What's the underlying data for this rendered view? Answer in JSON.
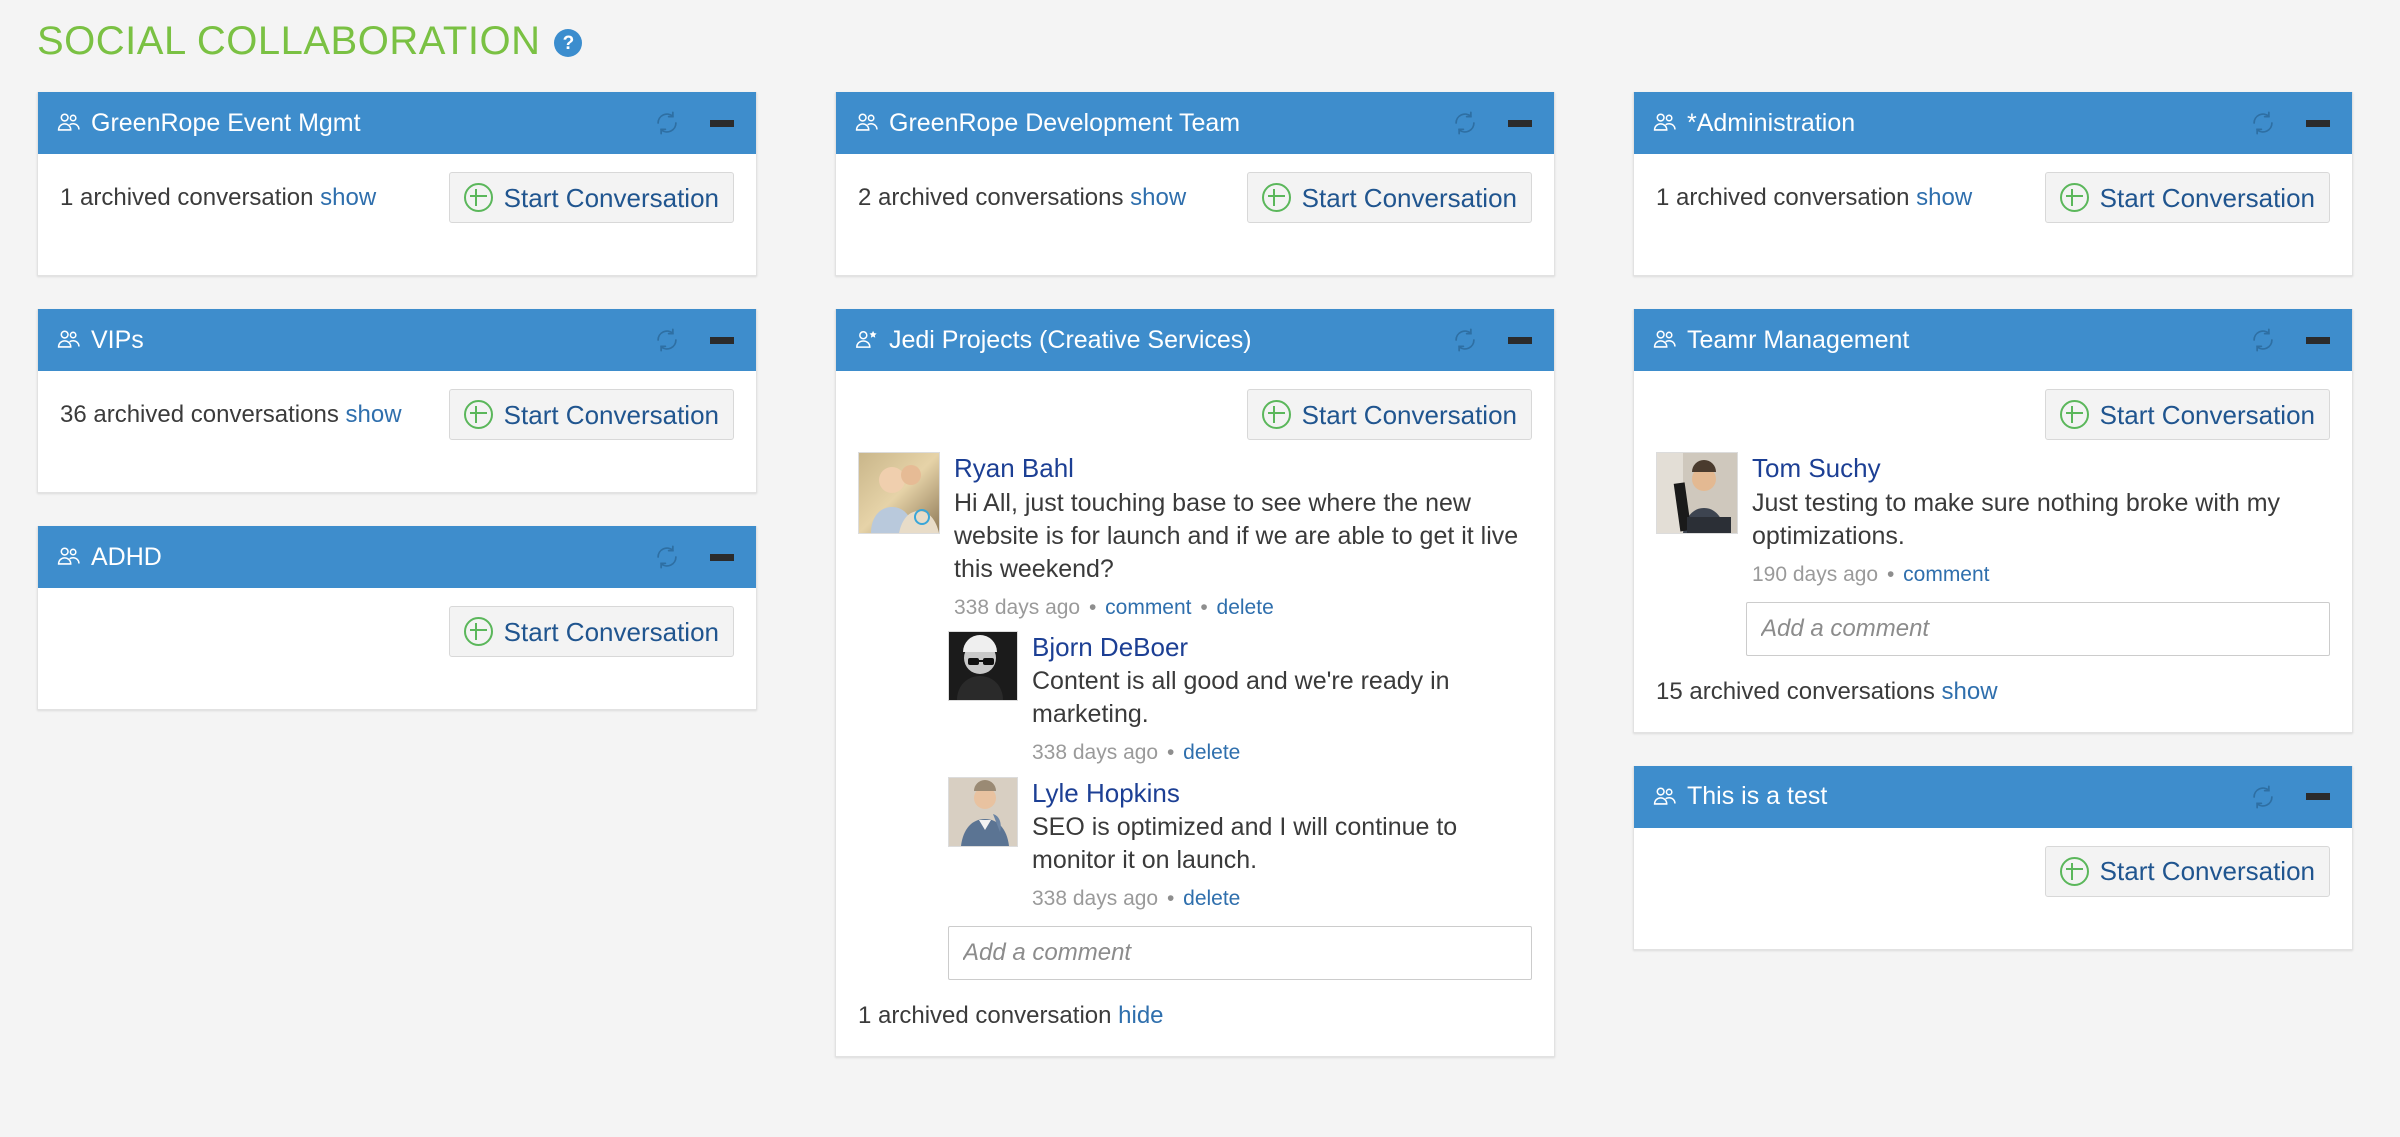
{
  "header": {
    "title": "SOCIAL COLLABORATION",
    "help_icon": "question-mark-icon",
    "help_label": "?",
    "title_color": "#7ac143",
    "help_bg_color": "#3b8dce"
  },
  "theme": {
    "card_header_bg": "#3e8dcc",
    "page_bg": "#f4f4f4",
    "link_color": "#2f6fad",
    "author_color": "#1c3f94",
    "plus_icon_color": "#5bb75b",
    "button_text_color": "#20558f"
  },
  "common": {
    "start_conversation_label": "Start Conversation",
    "comment_placeholder": "Add a comment",
    "refresh_icon": "refresh-icon",
    "minimize_icon": "minimize-icon",
    "group_icon": "group-users-icon",
    "user_star_icon": "user-star-icon",
    "plus_icon": "circle-plus-icon",
    "show_label": "show",
    "hide_label": "hide",
    "comment_label": "comment",
    "delete_label": "delete",
    "separator": "•"
  },
  "columns": [
    {
      "id": "column-1",
      "cards": [
        {
          "id": "greenrope-event-mgmt",
          "title": "GreenRope Event Mgmt",
          "icon": "group-users-icon",
          "archived_text": "1 archived conversation",
          "archived_action": "show",
          "archived_position": "top",
          "posts": []
        },
        {
          "id": "vips",
          "title": "VIPs",
          "icon": "group-users-icon",
          "archived_text": "36 archived conversations",
          "archived_action": "show",
          "archived_position": "top",
          "posts": []
        },
        {
          "id": "adhd",
          "title": "ADHD",
          "icon": "group-users-icon",
          "archived_text": "",
          "archived_action": "",
          "archived_position": "none",
          "posts": []
        }
      ]
    },
    {
      "id": "column-2",
      "cards": [
        {
          "id": "greenrope-development-team",
          "title": "GreenRope Development Team",
          "icon": "group-users-icon",
          "archived_text": "2 archived conversations",
          "archived_action": "show",
          "archived_position": "top",
          "posts": []
        },
        {
          "id": "jedi-projects-creative-services",
          "title": "Jedi Projects (Creative Services)",
          "icon": "user-star-icon",
          "archived_text": "1 archived conversation",
          "archived_action": "hide",
          "archived_position": "bottom",
          "posts": [
            {
              "author": "Ryan Bahl",
              "avatar": "photo-couple-outdoors",
              "text": "Hi All, just touching base to see where the new website is for launch and if we are able to get it live this weekend?",
              "time": "338 days ago",
              "actions": [
                "comment",
                "delete"
              ],
              "is_reply": false
            },
            {
              "author": "Bjorn DeBoer",
              "avatar": "photo-man-glasses-bw",
              "text": "Content is all good and we're ready in marketing.",
              "time": "338 days ago",
              "actions": [
                "delete"
              ],
              "is_reply": true
            },
            {
              "author": "Lyle Hopkins",
              "avatar": "photo-man-suit",
              "text": "SEO is optimized and I will continue to monitor it on launch.",
              "time": "338 days ago",
              "actions": [
                "delete"
              ],
              "is_reply": true
            }
          ],
          "comment_box": true,
          "comment_box_indented": true
        }
      ]
    },
    {
      "id": "column-3",
      "cards": [
        {
          "id": "administration",
          "title": "*Administration",
          "icon": "group-users-icon",
          "archived_text": "1 archived conversation",
          "archived_action": "show",
          "archived_position": "top",
          "posts": []
        },
        {
          "id": "teamr-management",
          "title": "Teamr Management",
          "icon": "group-users-icon",
          "archived_text": "15 archived conversations",
          "archived_action": "show",
          "archived_position": "bottom",
          "posts": [
            {
              "author": "Tom Suchy",
              "avatar": "photo-man-laptop",
              "text": "Just testing to make sure nothing broke with my optimizations.",
              "time": "190 days ago",
              "actions": [
                "comment"
              ],
              "is_reply": false
            }
          ],
          "comment_box": true,
          "comment_box_indented": true
        },
        {
          "id": "this-is-a-test",
          "title": "This is a test",
          "icon": "group-users-icon",
          "archived_text": "",
          "archived_action": "",
          "archived_position": "none",
          "posts": []
        }
      ]
    }
  ]
}
